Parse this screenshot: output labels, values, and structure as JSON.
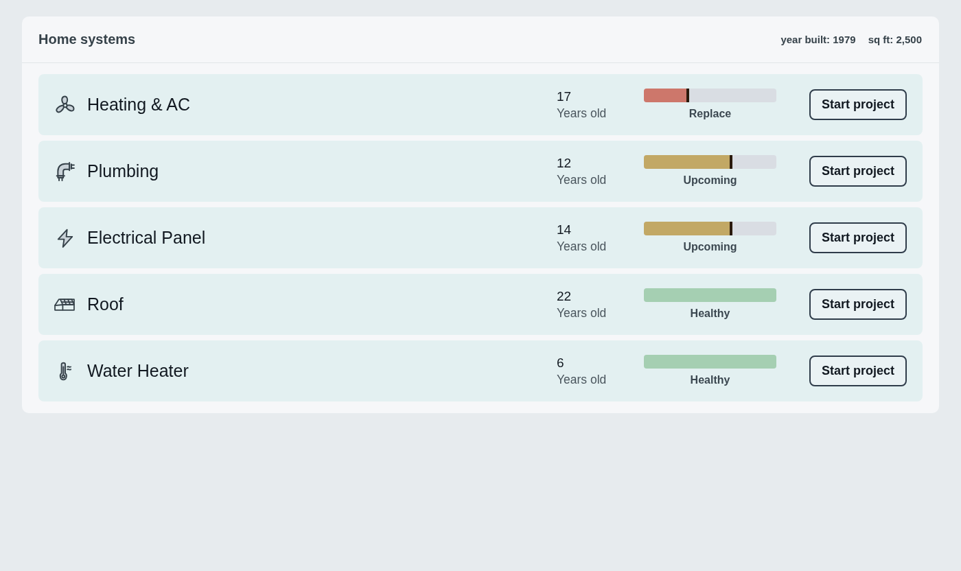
{
  "header": {
    "title": "Home systems",
    "meta": [
      "year built: 1979",
      "sq ft: 2,500"
    ]
  },
  "systems": [
    {
      "name": "Heating & AC",
      "age": "17",
      "age_label": "Years old",
      "level": 0.34,
      "color": "#cd776b",
      "status": "Replace",
      "button": "Start project"
    },
    {
      "name": "Plumbing",
      "age": "12",
      "age_label": "Years old",
      "level": 0.67,
      "color": "#c2a865",
      "status": "Upcoming",
      "button": "Start project"
    },
    {
      "name": "Electrical Panel",
      "age": "14",
      "age_label": "Years old",
      "level": 0.67,
      "color": "#c2a865",
      "status": "Upcoming",
      "button": "Start project"
    },
    {
      "name": "Roof",
      "age": "22",
      "age_label": "Years old",
      "level": 1,
      "color": "#a5cfb2",
      "status": "Healthy",
      "button": "Start project"
    },
    {
      "name": "Water Heater",
      "age": "6",
      "age_label": "Years old",
      "level": 1,
      "color": "#a5cfb2",
      "status": "Healthy",
      "button": "Start project"
    }
  ]
}
